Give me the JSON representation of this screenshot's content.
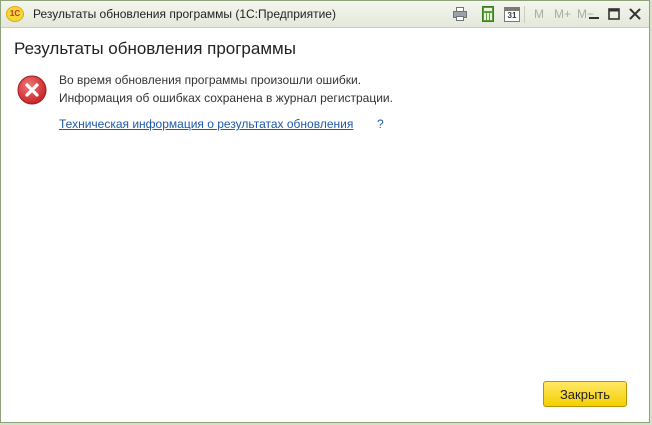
{
  "window": {
    "title": "Результаты обновления программы  (1С:Предприятие)",
    "logo_text": "1С"
  },
  "toolbar": {
    "icons": [
      "print-icon",
      "calculator-icon",
      "calendar-icon"
    ],
    "calendar_day": "31",
    "memory_buttons": [
      "M",
      "M+",
      "M−"
    ],
    "window_controls": [
      "minimize-icon",
      "maximize-icon",
      "close-icon"
    ]
  },
  "main": {
    "heading": "Результаты обновления программы",
    "error_icon": "error-icon",
    "messages": [
      "Во время обновления программы произошли ошибки.",
      "Информация об ошибках сохранена в журнал регистрации."
    ],
    "tech_link": "Техническая информация о результатах обновления",
    "help_mark": "?"
  },
  "footer": {
    "close_label": "Закрыть"
  },
  "colors": {
    "accent_button": "#f5cf00",
    "link": "#1e5aa8",
    "error": "#d63638"
  }
}
